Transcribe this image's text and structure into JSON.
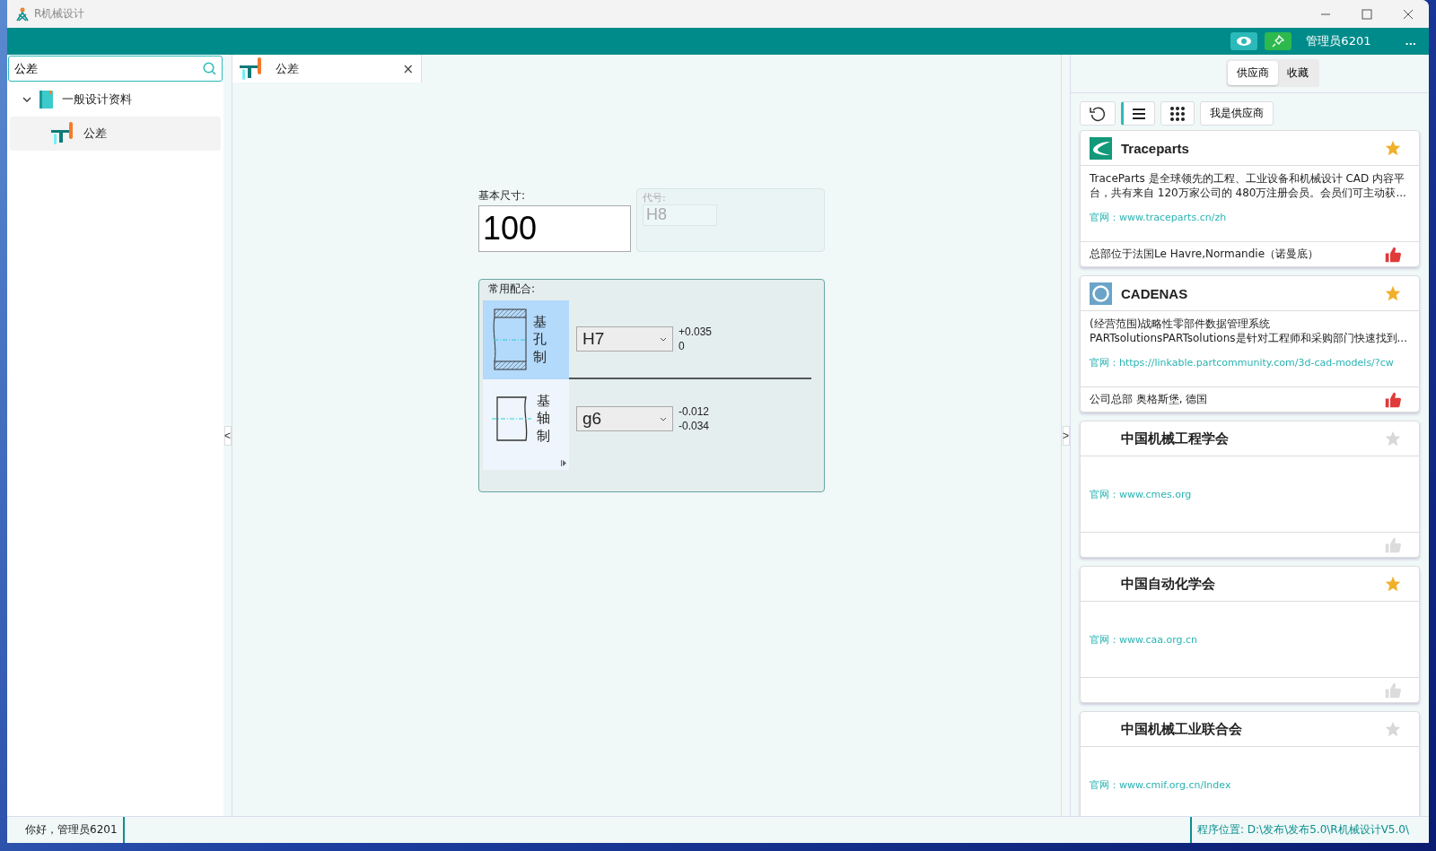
{
  "window": {
    "title": "R机械设计"
  },
  "header": {
    "user": "管理员6201",
    "more": "..."
  },
  "search": {
    "value": "公差"
  },
  "tree": [
    {
      "label": "一般设计资料",
      "expanded": true,
      "selected": false,
      "children": [
        {
          "label": "公差",
          "selected": true
        }
      ]
    }
  ],
  "doc_tabs": [
    {
      "label": "公差",
      "selected": true,
      "close": "×"
    }
  ],
  "splitters": {
    "left": "<",
    "right": ">"
  },
  "form": {
    "size_label": "基本尺寸:",
    "size": "100",
    "code_label": "代号:",
    "code": "H8",
    "code_disabled": true
  },
  "fits": {
    "title": "常用配合:",
    "systems": [
      {
        "kind": "hole",
        "label": "基孔制",
        "selected": true,
        "grade": "H7",
        "upper": "+0.035",
        "lower": "0"
      },
      {
        "kind": "shaft",
        "label": "基轴制",
        "selected": false,
        "grade": "g6",
        "upper": "-0.012",
        "lower": "-0.034"
      }
    ]
  },
  "right_tabs": [
    {
      "label": "供应商",
      "selected": true
    },
    {
      "label": "收藏",
      "selected": false
    }
  ],
  "toolbar": {
    "view_modes": [
      {
        "kind": "list",
        "selected": true
      },
      {
        "kind": "grid",
        "selected": false
      }
    ],
    "supplier_button": "我是供应商"
  },
  "suppliers": [
    {
      "name": "Traceparts",
      "kind": "swoosh",
      "starred": true,
      "description": "TraceParts 是全球领先的工程、工业设备和机械设计 CAD 内容平台，共有来自 120万家公司的 480万注册会员。会员们可主动获...",
      "site_label": "官网：",
      "site": "www.traceparts.cn/zh",
      "hq": "总部位于法国Le Havre,Normandie（诺曼底）",
      "liked": true
    },
    {
      "name": "CADENAS",
      "kind": "ring",
      "starred": true,
      "description": "(经营范围)战略性零部件数据管理系统PARTsolutionsPARTsolutions是针对工程师和采购部门快速找到...",
      "site_label": "官网：",
      "site": "https://linkable.partcommunity.com/3d-cad-models/?cw",
      "hq": "公司总部  奥格斯堡, 德国",
      "liked": true
    },
    {
      "name": "中国机械工程学会",
      "starred": false,
      "site_label": "官网：",
      "site": "www.cmes.org",
      "liked": false
    },
    {
      "name": "中国自动化学会",
      "starred": true,
      "site_label": "官网：",
      "site": "www.caa.org.cn",
      "liked": false
    },
    {
      "name": "中国机械工业联合会",
      "starred": false,
      "site_label": "官网：",
      "site": "www.cmif.org.cn/Index"
    }
  ],
  "status_bar": {
    "greeting": "你好，管理员6201",
    "path": "程序位置: D:\\发布\\发布5.0\\R机械设计V5.0\\"
  }
}
